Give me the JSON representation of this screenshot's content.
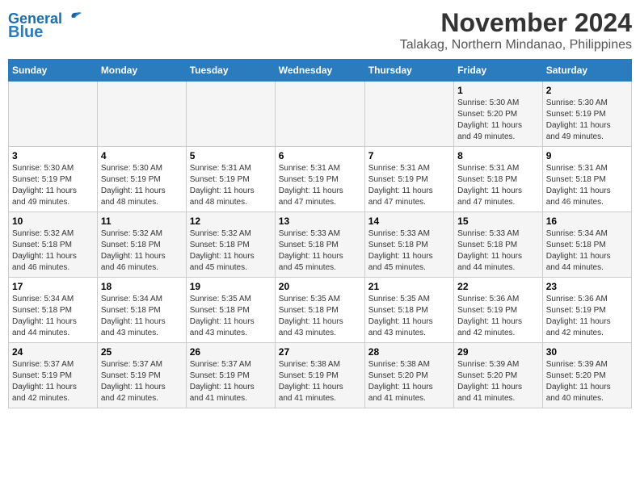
{
  "header": {
    "logo_line1": "General",
    "logo_line2": "Blue",
    "main_title": "November 2024",
    "subtitle": "Talakag, Northern Mindanao, Philippines"
  },
  "days_of_week": [
    "Sunday",
    "Monday",
    "Tuesday",
    "Wednesday",
    "Thursday",
    "Friday",
    "Saturday"
  ],
  "weeks": [
    [
      {
        "day": "",
        "info": ""
      },
      {
        "day": "",
        "info": ""
      },
      {
        "day": "",
        "info": ""
      },
      {
        "day": "",
        "info": ""
      },
      {
        "day": "",
        "info": ""
      },
      {
        "day": "1",
        "info": "Sunrise: 5:30 AM\nSunset: 5:20 PM\nDaylight: 11 hours\nand 49 minutes."
      },
      {
        "day": "2",
        "info": "Sunrise: 5:30 AM\nSunset: 5:19 PM\nDaylight: 11 hours\nand 49 minutes."
      }
    ],
    [
      {
        "day": "3",
        "info": "Sunrise: 5:30 AM\nSunset: 5:19 PM\nDaylight: 11 hours\nand 49 minutes."
      },
      {
        "day": "4",
        "info": "Sunrise: 5:30 AM\nSunset: 5:19 PM\nDaylight: 11 hours\nand 48 minutes."
      },
      {
        "day": "5",
        "info": "Sunrise: 5:31 AM\nSunset: 5:19 PM\nDaylight: 11 hours\nand 48 minutes."
      },
      {
        "day": "6",
        "info": "Sunrise: 5:31 AM\nSunset: 5:19 PM\nDaylight: 11 hours\nand 47 minutes."
      },
      {
        "day": "7",
        "info": "Sunrise: 5:31 AM\nSunset: 5:19 PM\nDaylight: 11 hours\nand 47 minutes."
      },
      {
        "day": "8",
        "info": "Sunrise: 5:31 AM\nSunset: 5:18 PM\nDaylight: 11 hours\nand 47 minutes."
      },
      {
        "day": "9",
        "info": "Sunrise: 5:31 AM\nSunset: 5:18 PM\nDaylight: 11 hours\nand 46 minutes."
      }
    ],
    [
      {
        "day": "10",
        "info": "Sunrise: 5:32 AM\nSunset: 5:18 PM\nDaylight: 11 hours\nand 46 minutes."
      },
      {
        "day": "11",
        "info": "Sunrise: 5:32 AM\nSunset: 5:18 PM\nDaylight: 11 hours\nand 46 minutes."
      },
      {
        "day": "12",
        "info": "Sunrise: 5:32 AM\nSunset: 5:18 PM\nDaylight: 11 hours\nand 45 minutes."
      },
      {
        "day": "13",
        "info": "Sunrise: 5:33 AM\nSunset: 5:18 PM\nDaylight: 11 hours\nand 45 minutes."
      },
      {
        "day": "14",
        "info": "Sunrise: 5:33 AM\nSunset: 5:18 PM\nDaylight: 11 hours\nand 45 minutes."
      },
      {
        "day": "15",
        "info": "Sunrise: 5:33 AM\nSunset: 5:18 PM\nDaylight: 11 hours\nand 44 minutes."
      },
      {
        "day": "16",
        "info": "Sunrise: 5:34 AM\nSunset: 5:18 PM\nDaylight: 11 hours\nand 44 minutes."
      }
    ],
    [
      {
        "day": "17",
        "info": "Sunrise: 5:34 AM\nSunset: 5:18 PM\nDaylight: 11 hours\nand 44 minutes."
      },
      {
        "day": "18",
        "info": "Sunrise: 5:34 AM\nSunset: 5:18 PM\nDaylight: 11 hours\nand 43 minutes."
      },
      {
        "day": "19",
        "info": "Sunrise: 5:35 AM\nSunset: 5:18 PM\nDaylight: 11 hours\nand 43 minutes."
      },
      {
        "day": "20",
        "info": "Sunrise: 5:35 AM\nSunset: 5:18 PM\nDaylight: 11 hours\nand 43 minutes."
      },
      {
        "day": "21",
        "info": "Sunrise: 5:35 AM\nSunset: 5:18 PM\nDaylight: 11 hours\nand 43 minutes."
      },
      {
        "day": "22",
        "info": "Sunrise: 5:36 AM\nSunset: 5:19 PM\nDaylight: 11 hours\nand 42 minutes."
      },
      {
        "day": "23",
        "info": "Sunrise: 5:36 AM\nSunset: 5:19 PM\nDaylight: 11 hours\nand 42 minutes."
      }
    ],
    [
      {
        "day": "24",
        "info": "Sunrise: 5:37 AM\nSunset: 5:19 PM\nDaylight: 11 hours\nand 42 minutes."
      },
      {
        "day": "25",
        "info": "Sunrise: 5:37 AM\nSunset: 5:19 PM\nDaylight: 11 hours\nand 42 minutes."
      },
      {
        "day": "26",
        "info": "Sunrise: 5:37 AM\nSunset: 5:19 PM\nDaylight: 11 hours\nand 41 minutes."
      },
      {
        "day": "27",
        "info": "Sunrise: 5:38 AM\nSunset: 5:19 PM\nDaylight: 11 hours\nand 41 minutes."
      },
      {
        "day": "28",
        "info": "Sunrise: 5:38 AM\nSunset: 5:20 PM\nDaylight: 11 hours\nand 41 minutes."
      },
      {
        "day": "29",
        "info": "Sunrise: 5:39 AM\nSunset: 5:20 PM\nDaylight: 11 hours\nand 41 minutes."
      },
      {
        "day": "30",
        "info": "Sunrise: 5:39 AM\nSunset: 5:20 PM\nDaylight: 11 hours\nand 40 minutes."
      }
    ]
  ]
}
